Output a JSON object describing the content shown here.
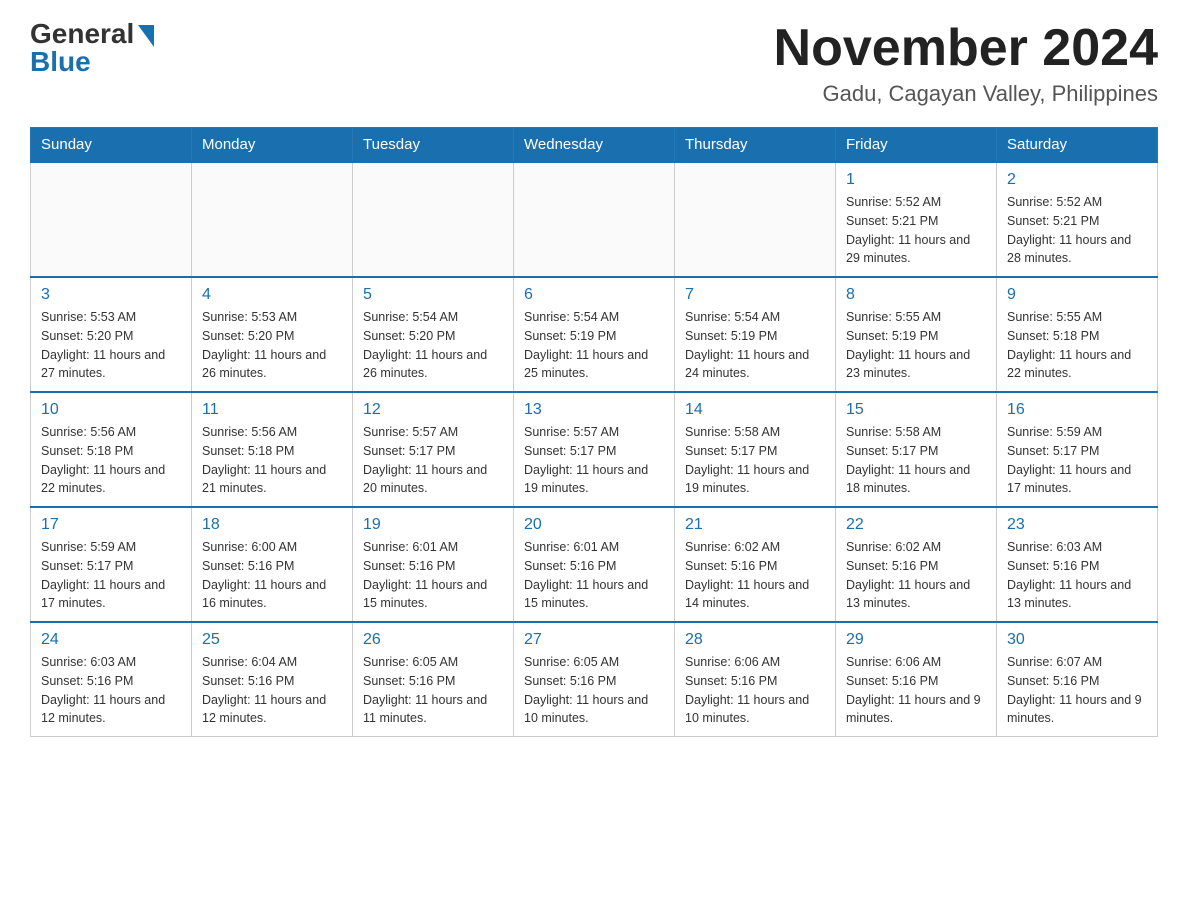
{
  "header": {
    "logo_general": "General",
    "logo_blue": "Blue",
    "month_title": "November 2024",
    "location": "Gadu, Cagayan Valley, Philippines"
  },
  "weekdays": [
    "Sunday",
    "Monday",
    "Tuesday",
    "Wednesday",
    "Thursday",
    "Friday",
    "Saturday"
  ],
  "weeks": [
    [
      {
        "day": "",
        "sunrise": "",
        "sunset": "",
        "daylight": ""
      },
      {
        "day": "",
        "sunrise": "",
        "sunset": "",
        "daylight": ""
      },
      {
        "day": "",
        "sunrise": "",
        "sunset": "",
        "daylight": ""
      },
      {
        "day": "",
        "sunrise": "",
        "sunset": "",
        "daylight": ""
      },
      {
        "day": "",
        "sunrise": "",
        "sunset": "",
        "daylight": ""
      },
      {
        "day": "1",
        "sunrise": "Sunrise: 5:52 AM",
        "sunset": "Sunset: 5:21 PM",
        "daylight": "Daylight: 11 hours and 29 minutes."
      },
      {
        "day": "2",
        "sunrise": "Sunrise: 5:52 AM",
        "sunset": "Sunset: 5:21 PM",
        "daylight": "Daylight: 11 hours and 28 minutes."
      }
    ],
    [
      {
        "day": "3",
        "sunrise": "Sunrise: 5:53 AM",
        "sunset": "Sunset: 5:20 PM",
        "daylight": "Daylight: 11 hours and 27 minutes."
      },
      {
        "day": "4",
        "sunrise": "Sunrise: 5:53 AM",
        "sunset": "Sunset: 5:20 PM",
        "daylight": "Daylight: 11 hours and 26 minutes."
      },
      {
        "day": "5",
        "sunrise": "Sunrise: 5:54 AM",
        "sunset": "Sunset: 5:20 PM",
        "daylight": "Daylight: 11 hours and 26 minutes."
      },
      {
        "day": "6",
        "sunrise": "Sunrise: 5:54 AM",
        "sunset": "Sunset: 5:19 PM",
        "daylight": "Daylight: 11 hours and 25 minutes."
      },
      {
        "day": "7",
        "sunrise": "Sunrise: 5:54 AM",
        "sunset": "Sunset: 5:19 PM",
        "daylight": "Daylight: 11 hours and 24 minutes."
      },
      {
        "day": "8",
        "sunrise": "Sunrise: 5:55 AM",
        "sunset": "Sunset: 5:19 PM",
        "daylight": "Daylight: 11 hours and 23 minutes."
      },
      {
        "day": "9",
        "sunrise": "Sunrise: 5:55 AM",
        "sunset": "Sunset: 5:18 PM",
        "daylight": "Daylight: 11 hours and 22 minutes."
      }
    ],
    [
      {
        "day": "10",
        "sunrise": "Sunrise: 5:56 AM",
        "sunset": "Sunset: 5:18 PM",
        "daylight": "Daylight: 11 hours and 22 minutes."
      },
      {
        "day": "11",
        "sunrise": "Sunrise: 5:56 AM",
        "sunset": "Sunset: 5:18 PM",
        "daylight": "Daylight: 11 hours and 21 minutes."
      },
      {
        "day": "12",
        "sunrise": "Sunrise: 5:57 AM",
        "sunset": "Sunset: 5:17 PM",
        "daylight": "Daylight: 11 hours and 20 minutes."
      },
      {
        "day": "13",
        "sunrise": "Sunrise: 5:57 AM",
        "sunset": "Sunset: 5:17 PM",
        "daylight": "Daylight: 11 hours and 19 minutes."
      },
      {
        "day": "14",
        "sunrise": "Sunrise: 5:58 AM",
        "sunset": "Sunset: 5:17 PM",
        "daylight": "Daylight: 11 hours and 19 minutes."
      },
      {
        "day": "15",
        "sunrise": "Sunrise: 5:58 AM",
        "sunset": "Sunset: 5:17 PM",
        "daylight": "Daylight: 11 hours and 18 minutes."
      },
      {
        "day": "16",
        "sunrise": "Sunrise: 5:59 AM",
        "sunset": "Sunset: 5:17 PM",
        "daylight": "Daylight: 11 hours and 17 minutes."
      }
    ],
    [
      {
        "day": "17",
        "sunrise": "Sunrise: 5:59 AM",
        "sunset": "Sunset: 5:17 PM",
        "daylight": "Daylight: 11 hours and 17 minutes."
      },
      {
        "day": "18",
        "sunrise": "Sunrise: 6:00 AM",
        "sunset": "Sunset: 5:16 PM",
        "daylight": "Daylight: 11 hours and 16 minutes."
      },
      {
        "day": "19",
        "sunrise": "Sunrise: 6:01 AM",
        "sunset": "Sunset: 5:16 PM",
        "daylight": "Daylight: 11 hours and 15 minutes."
      },
      {
        "day": "20",
        "sunrise": "Sunrise: 6:01 AM",
        "sunset": "Sunset: 5:16 PM",
        "daylight": "Daylight: 11 hours and 15 minutes."
      },
      {
        "day": "21",
        "sunrise": "Sunrise: 6:02 AM",
        "sunset": "Sunset: 5:16 PM",
        "daylight": "Daylight: 11 hours and 14 minutes."
      },
      {
        "day": "22",
        "sunrise": "Sunrise: 6:02 AM",
        "sunset": "Sunset: 5:16 PM",
        "daylight": "Daylight: 11 hours and 13 minutes."
      },
      {
        "day": "23",
        "sunrise": "Sunrise: 6:03 AM",
        "sunset": "Sunset: 5:16 PM",
        "daylight": "Daylight: 11 hours and 13 minutes."
      }
    ],
    [
      {
        "day": "24",
        "sunrise": "Sunrise: 6:03 AM",
        "sunset": "Sunset: 5:16 PM",
        "daylight": "Daylight: 11 hours and 12 minutes."
      },
      {
        "day": "25",
        "sunrise": "Sunrise: 6:04 AM",
        "sunset": "Sunset: 5:16 PM",
        "daylight": "Daylight: 11 hours and 12 minutes."
      },
      {
        "day": "26",
        "sunrise": "Sunrise: 6:05 AM",
        "sunset": "Sunset: 5:16 PM",
        "daylight": "Daylight: 11 hours and 11 minutes."
      },
      {
        "day": "27",
        "sunrise": "Sunrise: 6:05 AM",
        "sunset": "Sunset: 5:16 PM",
        "daylight": "Daylight: 11 hours and 10 minutes."
      },
      {
        "day": "28",
        "sunrise": "Sunrise: 6:06 AM",
        "sunset": "Sunset: 5:16 PM",
        "daylight": "Daylight: 11 hours and 10 minutes."
      },
      {
        "day": "29",
        "sunrise": "Sunrise: 6:06 AM",
        "sunset": "Sunset: 5:16 PM",
        "daylight": "Daylight: 11 hours and 9 minutes."
      },
      {
        "day": "30",
        "sunrise": "Sunrise: 6:07 AM",
        "sunset": "Sunset: 5:16 PM",
        "daylight": "Daylight: 11 hours and 9 minutes."
      }
    ]
  ]
}
